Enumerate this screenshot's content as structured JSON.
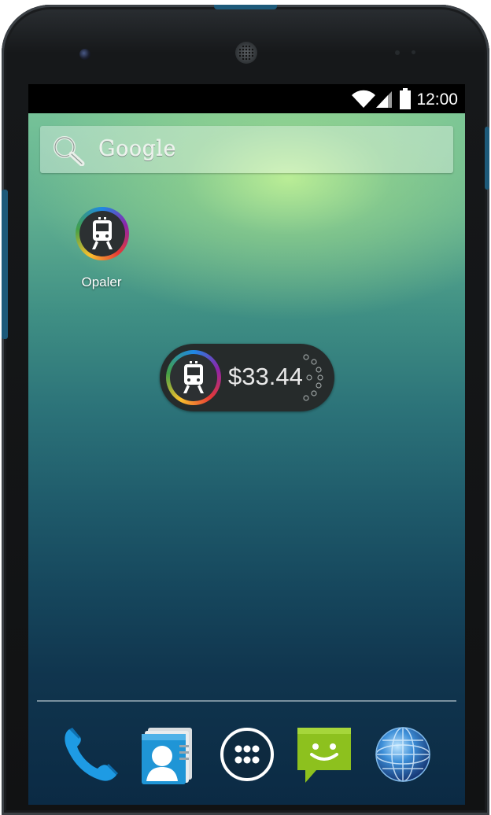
{
  "status_bar": {
    "time": "12:00",
    "icons": [
      "wifi-icon",
      "signal-icon",
      "battery-icon"
    ]
  },
  "search_bar": {
    "label": "Google",
    "icon": "search-icon"
  },
  "home_apps": [
    {
      "label": "Opaler",
      "icon": "train-icon"
    }
  ],
  "widget": {
    "balance": "$33.44",
    "icon": "train-icon",
    "refresh_icon": "loading-spinner-icon"
  },
  "dock": [
    {
      "icon": "phone-icon"
    },
    {
      "icon": "contacts-icon"
    },
    {
      "icon": "app-drawer-icon"
    },
    {
      "icon": "messaging-icon"
    },
    {
      "icon": "browser-globe-icon"
    }
  ],
  "colors": {
    "widget_bg": "#262b2b",
    "ring_blue": "#1e88e5",
    "ring_red": "#e53935",
    "ring_yellow": "#fbc02d",
    "ring_green": "#43a047",
    "ring_purple": "#8e24aa"
  }
}
